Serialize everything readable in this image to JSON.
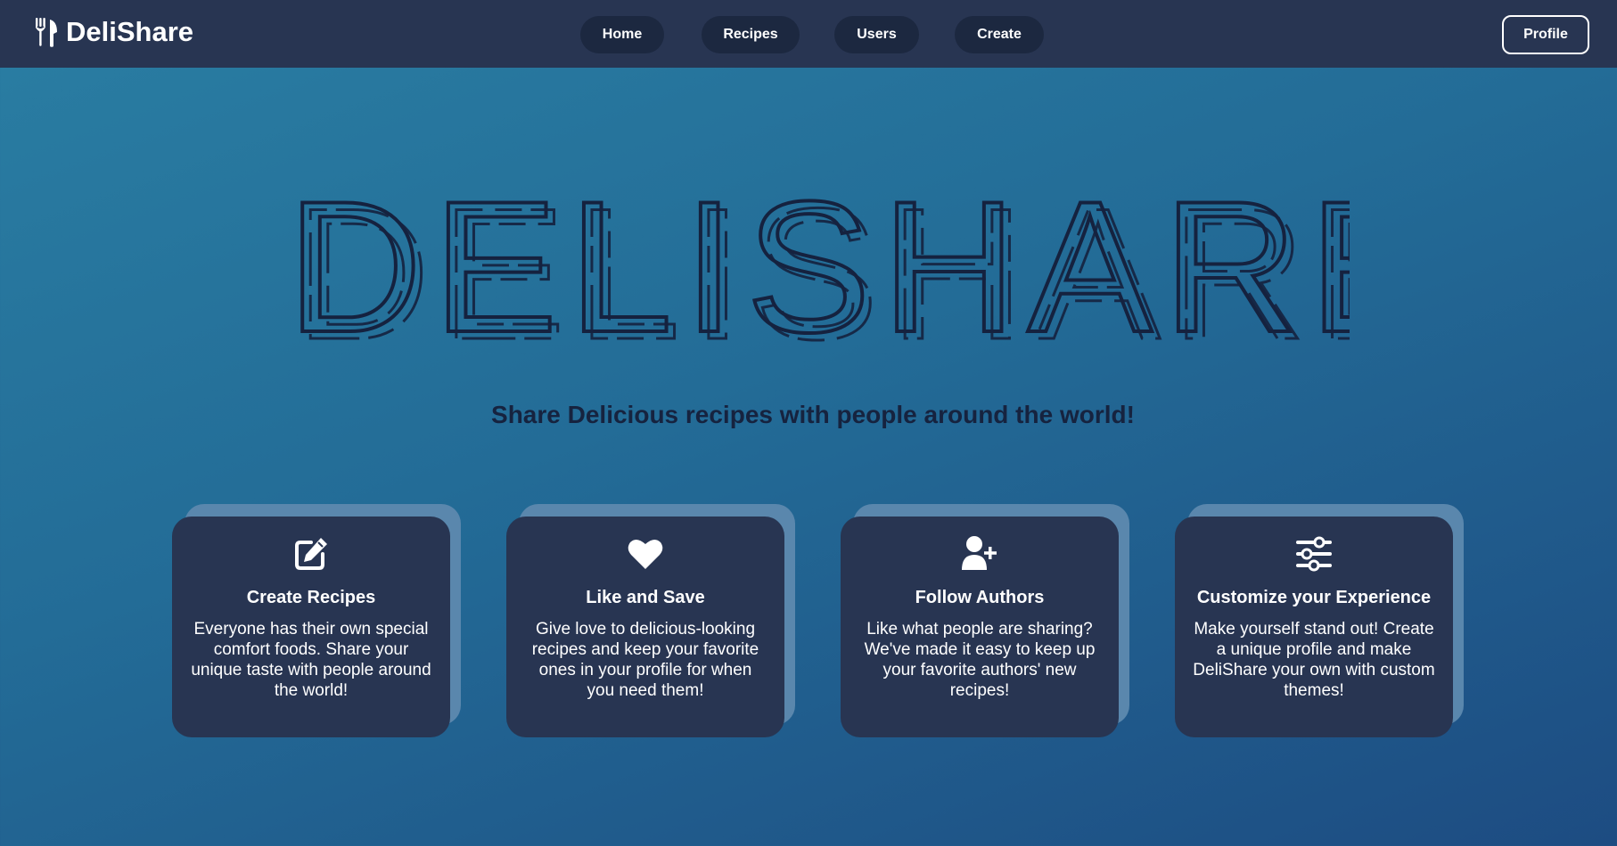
{
  "app": {
    "brand_name": "DeliShare"
  },
  "nav": {
    "links": [
      {
        "label": "Home"
      },
      {
        "label": "Recipes"
      },
      {
        "label": "Users"
      },
      {
        "label": "Create"
      }
    ],
    "profile_label": "Profile"
  },
  "hero": {
    "title": "DELISHARE",
    "tagline": "Share Delicious recipes with people around the world!"
  },
  "features": [
    {
      "icon": "edit-icon",
      "title": "Create Recipes",
      "text": "Everyone has their own special comfort foods. Share your unique taste with people around the world!"
    },
    {
      "icon": "heart-icon",
      "title": "Like and Save",
      "text": "Give love to delicious-looking recipes and keep your favorite ones in your profile for when you need them!"
    },
    {
      "icon": "user-plus-icon",
      "title": "Follow Authors",
      "text": "Like what people are sharing? We've made it easy to keep up your favorite authors' new recipes!"
    },
    {
      "icon": "sliders-icon",
      "title": "Customize your Experience",
      "text": "Make yourself stand out! Create a unique profile and make DeliShare your own with custom themes!"
    }
  ],
  "colors": {
    "navbar": "#283552",
    "nav_pill": "#1c2840",
    "card": "#283552",
    "card_back": "#5a87ad",
    "title_stroke": "#15223f",
    "background_top": "#2a7ea3",
    "background_bottom": "#1d4c82"
  }
}
